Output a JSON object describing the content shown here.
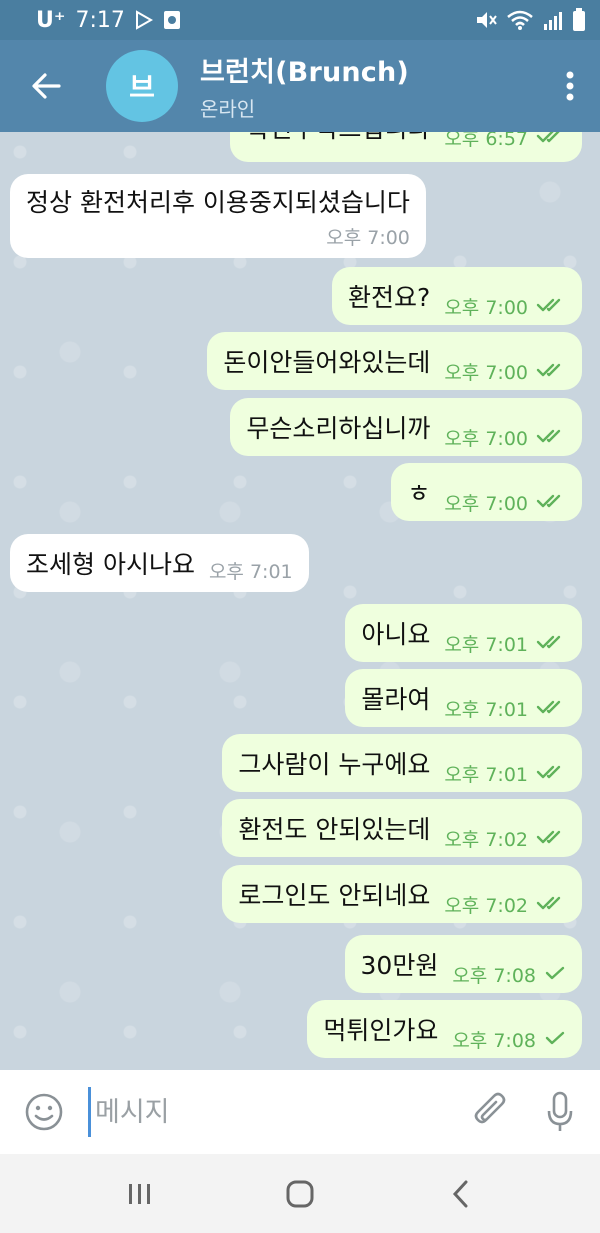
{
  "status_bar": {
    "carrier": "U⁺",
    "time": "7:17"
  },
  "header": {
    "avatar_letter": "브",
    "title": "브런치(Brunch)",
    "status": "온라인"
  },
  "messages": [
    {
      "dir": "out",
      "text": "확인부탁드립니다",
      "time": "오후 6:57",
      "read": true
    },
    {
      "dir": "in",
      "text": "정상 환전처리후 이용중지되셨습니다",
      "time": "오후 7:00"
    },
    {
      "dir": "out",
      "text": "환전요?",
      "time": "오후 7:00",
      "read": true
    },
    {
      "dir": "out",
      "text": "돈이안들어와있는데",
      "time": "오후 7:00",
      "read": true
    },
    {
      "dir": "out",
      "text": "무슨소리하십니까",
      "time": "오후 7:00",
      "read": true
    },
    {
      "dir": "out",
      "text": "ㅎ",
      "time": "오후 7:00",
      "read": true
    },
    {
      "dir": "in",
      "text": "조세형 아시나요",
      "time": "오후 7:01"
    },
    {
      "dir": "out",
      "text": "아니요",
      "time": "오후 7:01",
      "read": true
    },
    {
      "dir": "out",
      "text": "몰라여",
      "time": "오후 7:01",
      "read": true
    },
    {
      "dir": "out",
      "text": "그사람이 누구에요",
      "time": "오후 7:01",
      "read": true
    },
    {
      "dir": "out",
      "text": "환전도 안되있는데",
      "time": "오후 7:02",
      "read": true
    },
    {
      "dir": "out",
      "text": "로그인도 안되네요",
      "time": "오후 7:02",
      "read": true
    },
    {
      "dir": "out",
      "text": "30만원",
      "time": "오후 7:08",
      "read": false
    },
    {
      "dir": "out",
      "text": "먹튀인가요",
      "time": "오후 7:08",
      "read": false
    }
  ],
  "input": {
    "placeholder": "메시지"
  },
  "colors": {
    "header": "#5386ab",
    "outgoing_bubble": "#efffde",
    "incoming_bubble": "#ffffff",
    "check": "#5fb25a"
  }
}
